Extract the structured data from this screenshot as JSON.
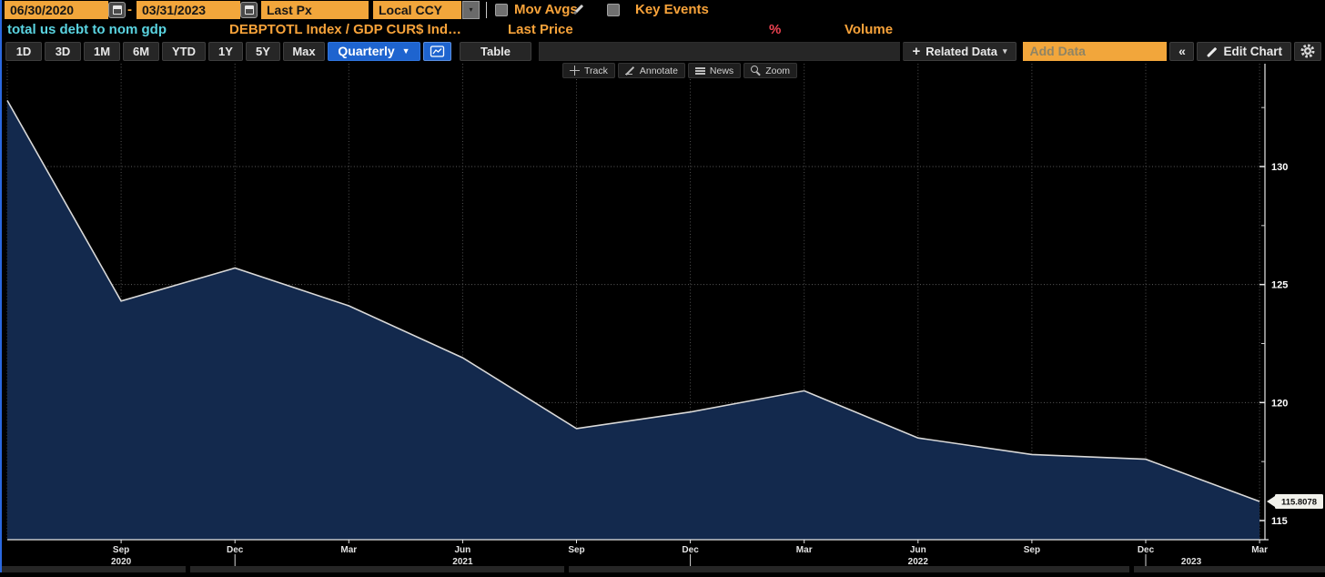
{
  "top_bar": {
    "date_from": "06/30/2020",
    "date_separator": "-",
    "date_to": "03/31/2023",
    "price_field": "Last Px",
    "currency_field": "Local CCY",
    "mov_avgs": "Mov Avgs",
    "key_events": "Key Events"
  },
  "legend": {
    "title": "total us debt to nom gdp",
    "security": "DEBPTOTL Index / GDP CUR$ Ind…",
    "price_type": "Last Price",
    "percent": "%",
    "volume": "Volume"
  },
  "toolbar": {
    "ranges": [
      "1D",
      "3D",
      "1M",
      "6M",
      "YTD",
      "1Y",
      "5Y",
      "Max"
    ],
    "period": "Quarterly",
    "table": "Table",
    "related_data": "Related Data",
    "add_data_placeholder": "Add Data",
    "collapse": "«",
    "edit_chart": "Edit Chart"
  },
  "icons": {
    "dropdown_arrow_solid": "▼",
    "dropdown_arrow_small": "▾",
    "dropdown_arrow_tiny": "▾",
    "plus": "+"
  },
  "chart_tools": [
    {
      "id": "track",
      "label": "Track"
    },
    {
      "id": "annotate",
      "label": "Annotate"
    },
    {
      "id": "news",
      "label": "News"
    },
    {
      "id": "zoom",
      "label": "Zoom"
    }
  ],
  "chart_data": {
    "type": "area",
    "title": "total us debt to nom gdp",
    "series": [
      {
        "name": "DEBPTOTL Index / GDP CUR$ Ind… - Last Price",
        "values": [
          132.8,
          124.3,
          125.7,
          124.1,
          121.9,
          118.9,
          119.6,
          120.5,
          118.5,
          117.8,
          117.6,
          115.8078
        ]
      }
    ],
    "x_dates": [
      "2020-06-30",
      "2020-09-30",
      "2020-12-31",
      "2021-03-31",
      "2021-06-30",
      "2021-09-30",
      "2021-12-31",
      "2022-03-31",
      "2022-06-30",
      "2022-09-30",
      "2022-12-31",
      "2023-03-31"
    ],
    "x_tick_months": [
      "Sep",
      "Dec",
      "Mar",
      "Jun",
      "Sep",
      "Dec",
      "Mar",
      "Jun",
      "Sep",
      "Dec",
      "Mar"
    ],
    "x_year_labels": [
      {
        "text": "2020",
        "at": 1
      },
      {
        "text": "2021",
        "at": 4
      },
      {
        "text": "2022",
        "at": 8
      },
      {
        "text": "2023",
        "at": 10.4
      }
    ],
    "year_separators_at": [
      2,
      6,
      10
    ],
    "y_ticks": [
      115,
      120,
      125,
      130
    ],
    "y_minor_ticks": [
      117.5,
      122.5,
      127.5,
      132.5
    ],
    "ylim": [
      114.2,
      134.4
    ],
    "last_price_label": "115.8078",
    "grid": "dotted",
    "axis_side": "right",
    "legend_position": "none",
    "line_color": "#d9d9d9",
    "fill_color": "#13294d",
    "background_color": "#000000"
  },
  "colors": {
    "accent_amber": "#f8a33a",
    "field_bg": "#f2a63b",
    "cyan": "#5ad4e1",
    "red": "#ef4352",
    "blue_button": "#1e64cf",
    "window_edge_blue": "#2a68e0"
  }
}
